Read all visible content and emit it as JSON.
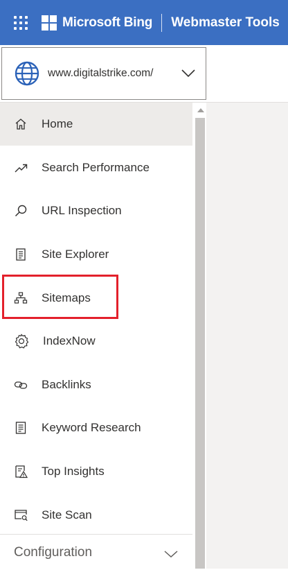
{
  "header": {
    "brand": "Microsoft Bing",
    "product": "Webmaster Tools",
    "icons": [
      "app-launcher-icon",
      "microsoft-logo-icon"
    ]
  },
  "site_picker": {
    "url": "www.digitalstrike.com/",
    "icons": [
      "globe-icon",
      "chevron-down-icon"
    ]
  },
  "nav": {
    "items": [
      {
        "label": "Home",
        "icon": "home-icon",
        "active": true
      },
      {
        "label": "Search Performance",
        "icon": "trend-up-icon"
      },
      {
        "label": "URL Inspection",
        "icon": "search-icon"
      },
      {
        "label": "Site Explorer",
        "icon": "document-list-icon"
      },
      {
        "label": "Sitemaps",
        "icon": "sitemap-icon"
      },
      {
        "label": "IndexNow",
        "icon": "gear-icon"
      },
      {
        "label": "Backlinks",
        "icon": "link-icon"
      },
      {
        "label": "Keyword Research",
        "icon": "keyword-document-icon"
      },
      {
        "label": "Top Insights",
        "icon": "insights-icon"
      },
      {
        "label": "Site Scan",
        "icon": "site-scan-icon"
      }
    ],
    "section": {
      "label": "Configuration",
      "icon": "chevron-down-icon"
    }
  },
  "colors": {
    "header_bg": "#3b6fc2",
    "active_bg": "#edebe9",
    "highlight": "#e3202b"
  }
}
